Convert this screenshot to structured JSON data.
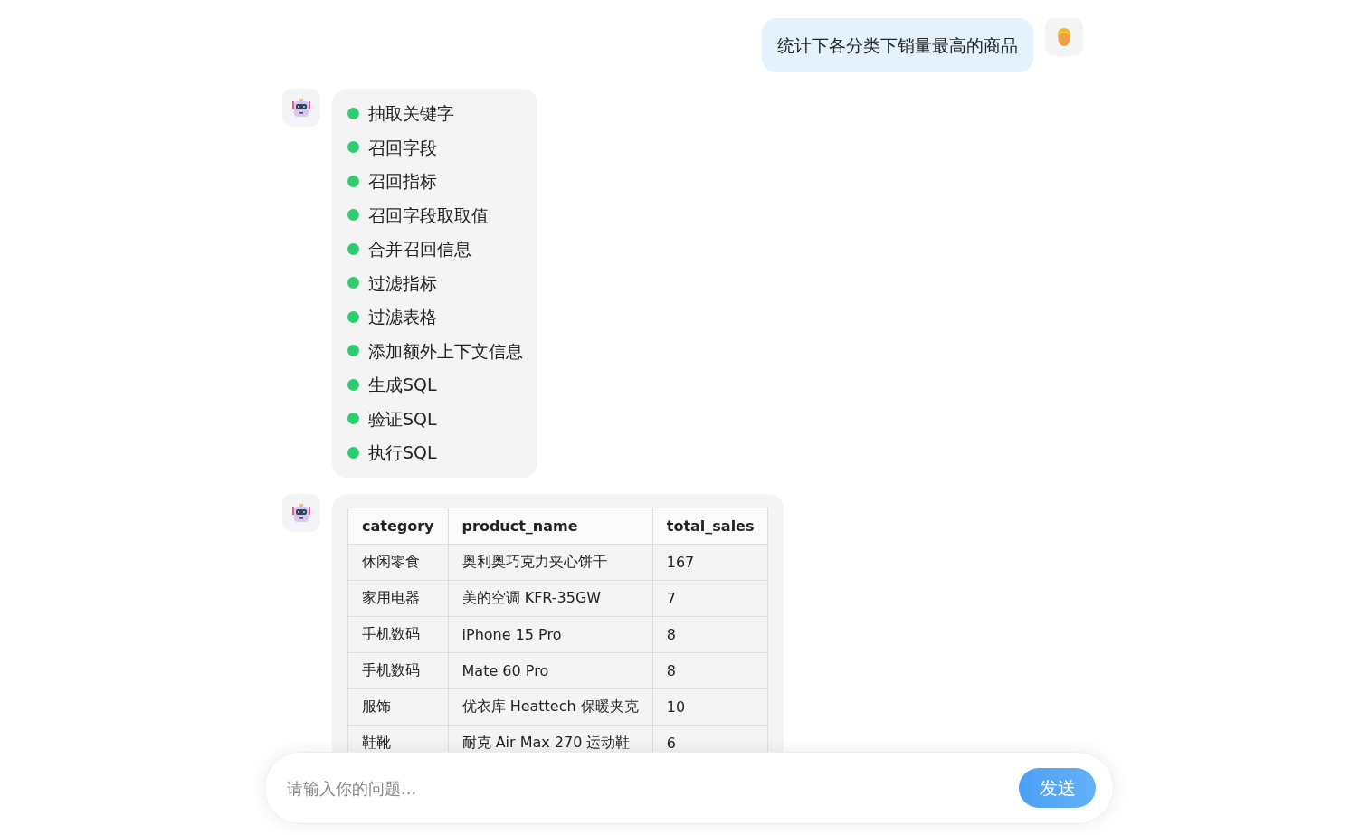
{
  "messages": [
    {
      "kind": "question",
      "text": "统计下各分类下销量最高的商品"
    },
    {
      "kind": "steps",
      "steps": [
        {
          "label": "抽取关键字",
          "color": "#2ecc71"
        },
        {
          "label": "召回字段",
          "color": "#2ecc71"
        },
        {
          "label": "召回指标",
          "color": "#2ecc71"
        },
        {
          "label": "召回字段取取值",
          "color": "#2ecc71"
        },
        {
          "label": "合并召回信息",
          "color": "#2ecc71"
        },
        {
          "label": "过滤指标",
          "color": "#2ecc71"
        },
        {
          "label": "过滤表格",
          "color": "#2ecc71"
        },
        {
          "label": "添加额外上下文信息",
          "color": "#2ecc71"
        },
        {
          "label": "生成SQL",
          "color": "#2ecc71"
        },
        {
          "label": "验证SQL",
          "color": "#2ecc71"
        },
        {
          "label": "执行SQL",
          "color": "#2ecc71"
        }
      ]
    },
    {
      "kind": "table",
      "table": {
        "columns": [
          "category",
          "product_name",
          "total_sales"
        ],
        "rows": [
          [
            "休闲零食",
            "奥利奥巧克力夹心饼干",
            "167"
          ],
          [
            "家用电器",
            "美的空调 KFR-35GW",
            "7"
          ],
          [
            "手机数码",
            "iPhone 15 Pro",
            "8"
          ],
          [
            "手机数码",
            "Mate 60 Pro",
            "8"
          ],
          [
            "服饰",
            "优衣库 Heattech 保暖夹克",
            "10"
          ],
          [
            "鞋靴",
            "耐克 Air Max 270 运动鞋",
            "6"
          ]
        ]
      }
    }
  ],
  "input": {
    "placeholder": "请输入你的问题...",
    "button": "发送"
  }
}
